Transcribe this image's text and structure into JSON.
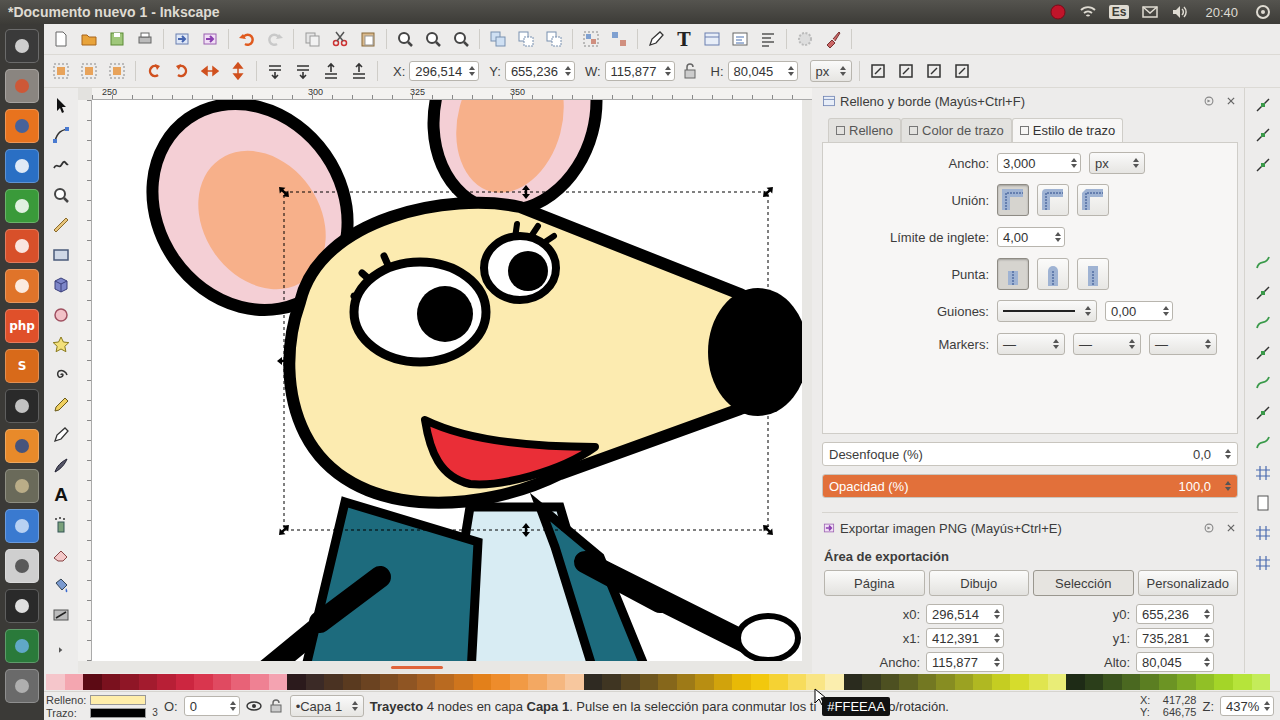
{
  "window": {
    "title": "*Documento nuevo 1 - Inkscape"
  },
  "system_panel": {
    "keyboard": "Es",
    "clock": "20:40"
  },
  "launcher": {
    "badges": [
      "php",
      "S"
    ]
  },
  "glyphs": {
    "text_command": "T",
    "text_tool": "A"
  },
  "tool_controls": {
    "fields": [
      {
        "label": "X:",
        "value": "296,514"
      },
      {
        "label": "Y:",
        "value": "655,236"
      },
      {
        "label": "W:",
        "value": "115,877"
      },
      {
        "label": "H:",
        "value": "80,045"
      }
    ],
    "lock_on": false,
    "unit": "px"
  },
  "ruler": {
    "ticks": [
      "250",
      "300",
      "325",
      "350"
    ]
  },
  "fill_stroke": {
    "title": "Relleno y borde (Mayús+Ctrl+F)",
    "tabs": [
      {
        "label": "Relleno",
        "selected": false
      },
      {
        "label": "Color de trazo",
        "selected": false
      },
      {
        "label": "Estilo de trazo",
        "selected": true
      }
    ],
    "width": {
      "label": "Ancho:",
      "value": "3,000",
      "unit": "px"
    },
    "join": {
      "label": "Unión:",
      "options": [
        {
          "kind": "miter",
          "selected": true
        },
        {
          "kind": "round",
          "selected": false
        },
        {
          "kind": "bevel",
          "selected": false
        }
      ]
    },
    "miter_limit": {
      "label": "Límite de inglete:",
      "value": "4,00"
    },
    "cap": {
      "label": "Punta:",
      "options": [
        {
          "kind": "butt",
          "selected": true
        },
        {
          "kind": "round",
          "selected": false
        },
        {
          "kind": "square",
          "selected": false
        }
      ]
    },
    "dashes": {
      "label": "Guiones:",
      "value": "0,00"
    },
    "markers": {
      "label": "Markers:",
      "slots": [
        "—",
        "—",
        "—"
      ]
    },
    "blur": {
      "label": "Desenfoque (%)",
      "value": "0,0",
      "level": 0
    },
    "opacity": {
      "label": "Opacidad (%)",
      "value": "100,0",
      "level": 1
    }
  },
  "export": {
    "title": "Exportar imagen PNG (Mayús+Ctrl+E)",
    "section": "Área de exportación",
    "buttons": [
      {
        "label": "Página",
        "selected": false
      },
      {
        "label": "Dibujo",
        "selected": false
      },
      {
        "label": "Selección",
        "selected": true
      },
      {
        "label": "Personalizado",
        "selected": false
      }
    ],
    "fields": [
      {
        "label": "x0:",
        "value": "296,514"
      },
      {
        "label": "y0:",
        "value": "655,236"
      },
      {
        "label": "x1:",
        "value": "412,391"
      },
      {
        "label": "y1:",
        "value": "735,281"
      },
      {
        "label": "Ancho:",
        "value": "115,877"
      },
      {
        "label": "Alto:",
        "value": "80,045"
      }
    ]
  },
  "palette": [
    "#f5c6cb",
    "#f4a6b0",
    "#5c0a14",
    "#7a111e",
    "#8f1626",
    "#a31b2e",
    "#b81f36",
    "#cc2640",
    "#d9364e",
    "#e04a61",
    "#e86277",
    "#ef8193",
    "#f4a3b1",
    "#2b1a1c",
    "#3b2a26",
    "#4a3222",
    "#5a3a1f",
    "#6b4321",
    "#7d4c22",
    "#8f5523",
    "#a45f22",
    "#b96a20",
    "#cf751d",
    "#e3801a",
    "#ee8c2b",
    "#f19a45",
    "#f3a862",
    "#f5b780",
    "#f7c79e",
    "#2f2a22",
    "#3f3522",
    "#574520",
    "#6e561e",
    "#86671b",
    "#9e7a17",
    "#b88e12",
    "#d1a30c",
    "#e8b906",
    "#f2c80d",
    "#f5d233",
    "#f7dc5c",
    "#f9e585",
    "#fbeeae",
    "#2a2b1e",
    "#3a3c20",
    "#4d5021",
    "#606422",
    "#737822",
    "#878d22",
    "#9ba222",
    "#b0b822",
    "#c5cd22",
    "#d6dc2c",
    "#e0e54f",
    "#e9ed77",
    "#1e2b16",
    "#2b3e1a",
    "#3a531d",
    "#4a6820",
    "#5b7e22",
    "#6c9424",
    "#7eaa25",
    "#91c026",
    "#a4d528",
    "#b6e43a",
    "#c4ec5a"
  ],
  "status_bar": {
    "fill_label": "Relleno:",
    "stroke_label": "Trazo:",
    "fill_color": "#ffeeaa",
    "stroke_color": "#000000",
    "stroke_width": "3",
    "opacity_label": "O:",
    "opacity_value": "0",
    "layer": "•Capa 1",
    "message": [
      {
        "text": "Trayecto",
        "bold": true
      },
      {
        "text": " 4 nodes en capa ",
        "bold": false
      },
      {
        "text": "Capa 1",
        "bold": true
      },
      {
        "text": ". Pulse en la selección para conmutar los ti",
        "bold": false
      }
    ],
    "message_end": "o/rotación.",
    "tooltip": "#FFEEAA",
    "cursor_x": {
      "label": "X:",
      "value": "417,28"
    },
    "cursor_y": {
      "label": "Y:",
      "value": "646,75"
    },
    "zoom": {
      "label": "Z:",
      "value": "437%"
    }
  }
}
